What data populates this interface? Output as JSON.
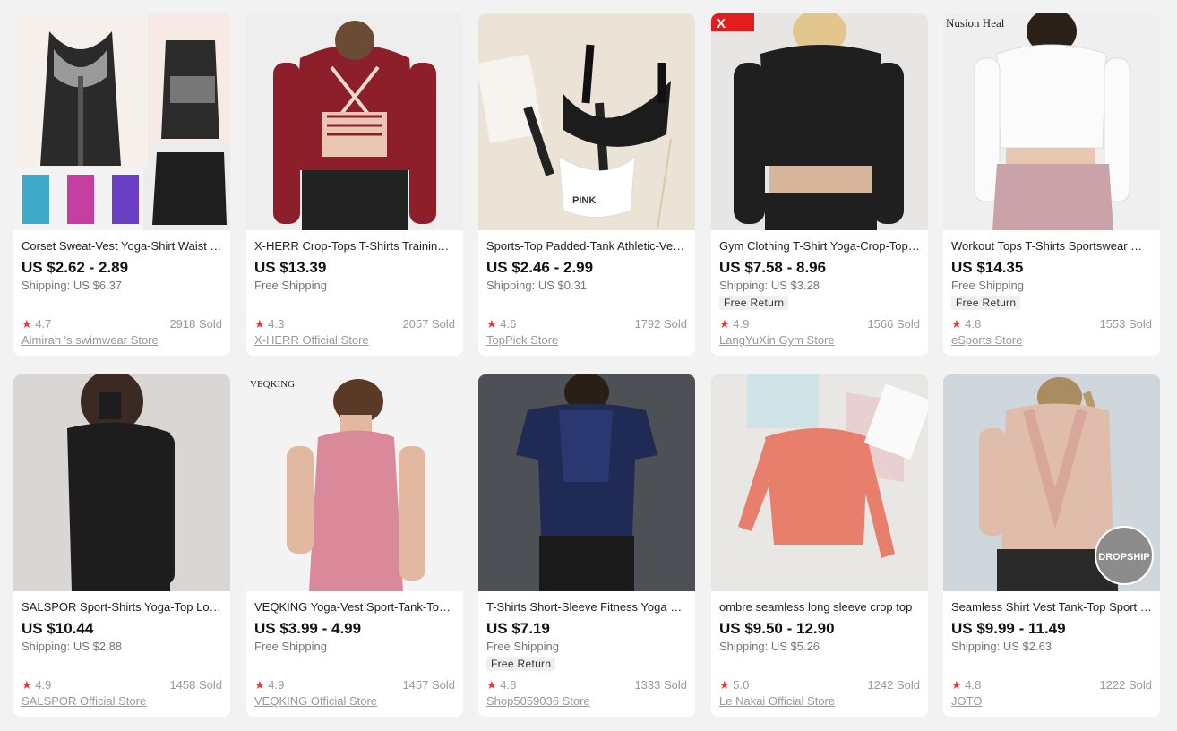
{
  "products": [
    {
      "title": "Corset Sweat-Vest Yoga-Shirt Waist Trainer",
      "price": "US $2.62 - 2.89",
      "shipping": "Shipping: US $6.37",
      "free_return": "",
      "rating": "4.7",
      "sold": "2918 Sold",
      "store": "Almirah 's swimwear Store",
      "image_text": ""
    },
    {
      "title": "X-HERR Crop-Tops T-Shirts Training Yoga",
      "price": "US $13.39",
      "shipping": "Free Shipping",
      "free_return": "",
      "rating": "4.3",
      "sold": "2057 Sold",
      "store": "X-HERR Official Store",
      "image_text": ""
    },
    {
      "title": "Sports-Top Padded-Tank Athletic-Vest Bra",
      "price": "US $2.46 - 2.99",
      "shipping": "Shipping: US $0.31",
      "free_return": "",
      "rating": "4.6",
      "sold": "1792 Sold",
      "store": "TopPick Store",
      "image_text": "PINK"
    },
    {
      "title": "Gym Clothing T-Shirt Yoga-Crop-Top Seamless",
      "price": "US $7.58 - 8.96",
      "shipping": "Shipping: US $3.28",
      "free_return": "Free Return",
      "rating": "4.9",
      "sold": "1566 Sold",
      "store": "LangYuXin Gym Store",
      "image_text": ""
    },
    {
      "title": "Workout Tops T-Shirts Sportswear Women",
      "price": "US $14.35",
      "shipping": "Free Shipping",
      "free_return": "Free Return",
      "rating": "4.8",
      "sold": "1553 Sold",
      "store": "eSports Store",
      "image_text": "Nusion Heal"
    },
    {
      "title": "SALSPOR Sport-Shirts Yoga-Top Long Sleeve",
      "price": "US $10.44",
      "shipping": "Shipping: US $2.88",
      "free_return": "",
      "rating": "4.9",
      "sold": "1458 Sold",
      "store": "SALSPOR Official Store",
      "image_text": ""
    },
    {
      "title": "VEQKING Yoga-Vest Sport-Tank-Tops Women",
      "price": "US $3.99 - 4.99",
      "shipping": "Free Shipping",
      "free_return": "",
      "rating": "4.9",
      "sold": "1457 Sold",
      "store": "VEQKING Official Store",
      "image_text": "VEQKING"
    },
    {
      "title": "T-Shirts Short-Sleeve Fitness Yoga Women",
      "price": "US $7.19",
      "shipping": "Free Shipping",
      "free_return": "Free Return",
      "rating": "4.8",
      "sold": "1333 Sold",
      "store": "Shop5059036 Store",
      "image_text": ""
    },
    {
      "title": "ombre seamless long sleeve crop top",
      "price": "US $9.50 - 12.90",
      "shipping": "Shipping: US $5.26",
      "free_return": "",
      "rating": "5.0",
      "sold": "1242 Sold",
      "store": "Le Nakai Official Store",
      "image_text": ""
    },
    {
      "title": "Seamless Shirt Vest Tank-Top Sport Women",
      "price": "US $9.99 - 11.49",
      "shipping": "Shipping: US $2.63",
      "free_return": "",
      "rating": "4.8",
      "sold": "1222 Sold",
      "store": "JOTO",
      "image_text": "DROPSHIP"
    }
  ],
  "star_icon": "star-icon",
  "colors": {
    "star": "#e83a3a",
    "background": "#f2f2f2",
    "muted": "#999999"
  }
}
